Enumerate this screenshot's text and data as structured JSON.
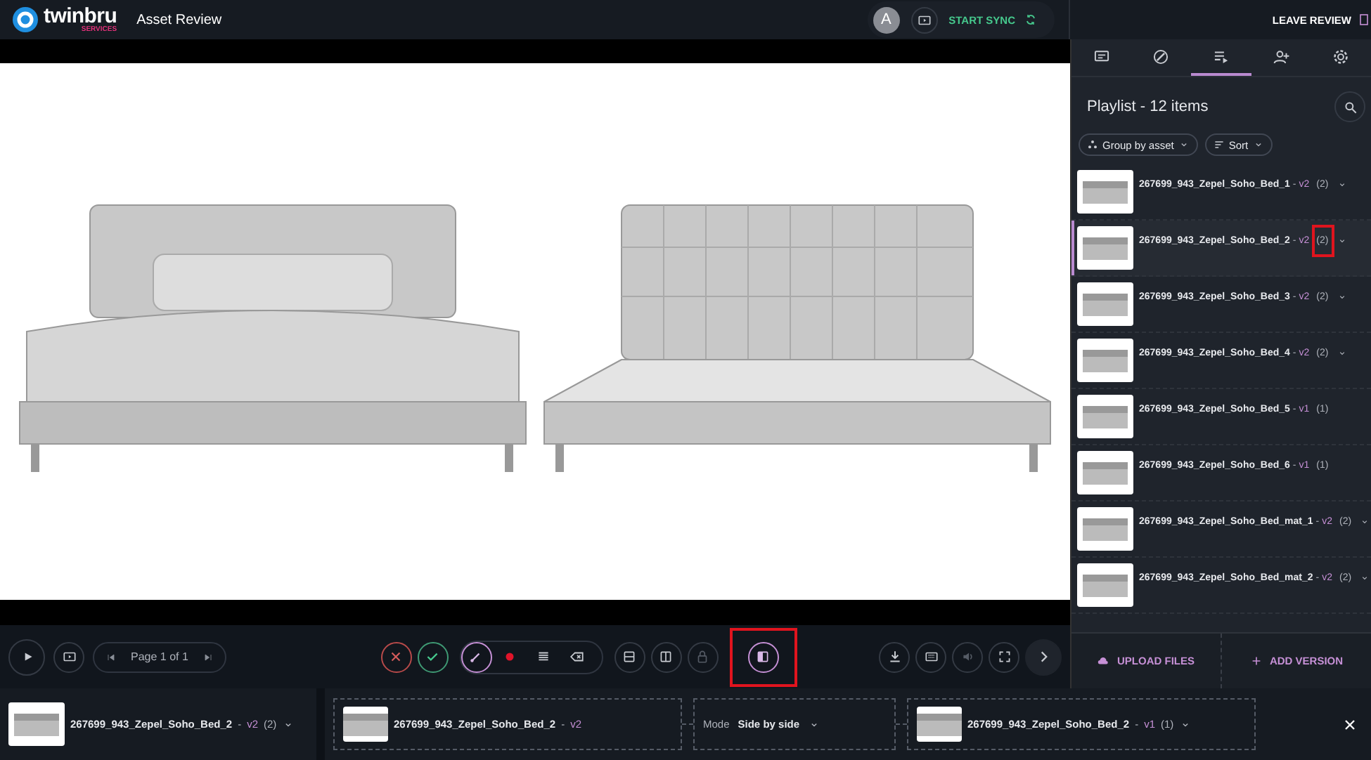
{
  "header": {
    "logo_name": "twinbru",
    "logo_sub": "SERVICES",
    "title": "Asset Review",
    "avatar": "A",
    "sync_label": "START SYNC",
    "leave_label": "LEAVE REVIEW"
  },
  "viewer": {
    "renders": [
      {
        "kind": "made-bed"
      },
      {
        "kind": "bed-frame"
      }
    ]
  },
  "sidebar": {
    "tabs": [
      {
        "selected": false
      },
      {
        "selected": false
      },
      {
        "selected": true
      },
      {
        "selected": false
      },
      {
        "selected": false
      }
    ],
    "title": "Playlist - 12 items",
    "chips": [
      {
        "label": "Group by asset"
      },
      {
        "label": "Sort"
      }
    ],
    "items": [
      {
        "name": "267699_943_Zepel_Soho_Bed_1",
        "separator": "-",
        "version": "v2",
        "count": "(2)",
        "expandable": true,
        "selected": false,
        "highlighted": false
      },
      {
        "name": "267699_943_Zepel_Soho_Bed_2",
        "separator": "-",
        "version": "v2",
        "count": "(2)",
        "expandable": true,
        "selected": true,
        "highlighted": true
      },
      {
        "name": "267699_943_Zepel_Soho_Bed_3",
        "separator": "-",
        "version": "v2",
        "count": "(2)",
        "expandable": true,
        "selected": false,
        "highlighted": false
      },
      {
        "name": "267699_943_Zepel_Soho_Bed_4",
        "separator": "-",
        "version": "v2",
        "count": "(2)",
        "expandable": true,
        "selected": false,
        "highlighted": false
      },
      {
        "name": "267699_943_Zepel_Soho_Bed_5",
        "separator": "-",
        "version": "v1",
        "count": "(1)",
        "expandable": false,
        "selected": false,
        "highlighted": false
      },
      {
        "name": "267699_943_Zepel_Soho_Bed_6",
        "separator": "-",
        "version": "v1",
        "count": "(1)",
        "expandable": false,
        "selected": false,
        "highlighted": false
      },
      {
        "name": "267699_943_Zepel_Soho_Bed_mat_1",
        "separator": "-",
        "version": "v2",
        "count": "(2)",
        "expandable": true,
        "selected": false,
        "highlighted": false
      },
      {
        "name": "267699_943_Zepel_Soho_Bed_mat_2",
        "separator": "-",
        "version": "v2",
        "count": "(2)",
        "expandable": true,
        "selected": false,
        "highlighted": false
      }
    ],
    "upload_label": "UPLOAD FILES",
    "add_label": "ADD VERSION"
  },
  "toolbar": {
    "page_label": "Page 1 of 1",
    "compare_highlighted": true
  },
  "compare": {
    "current": {
      "name": "267699_943_Zepel_Soho_Bed_2",
      "separator": "-",
      "version": "v2",
      "count": "(2)"
    },
    "left": {
      "name": "267699_943_Zepel_Soho_Bed_2",
      "separator": "-",
      "version": "v2"
    },
    "mode_label": "Mode",
    "mode_value": "Side by side",
    "right": {
      "name": "267699_943_Zepel_Soho_Bed_2",
      "separator": "-",
      "version": "v1",
      "count": "(1)"
    }
  }
}
